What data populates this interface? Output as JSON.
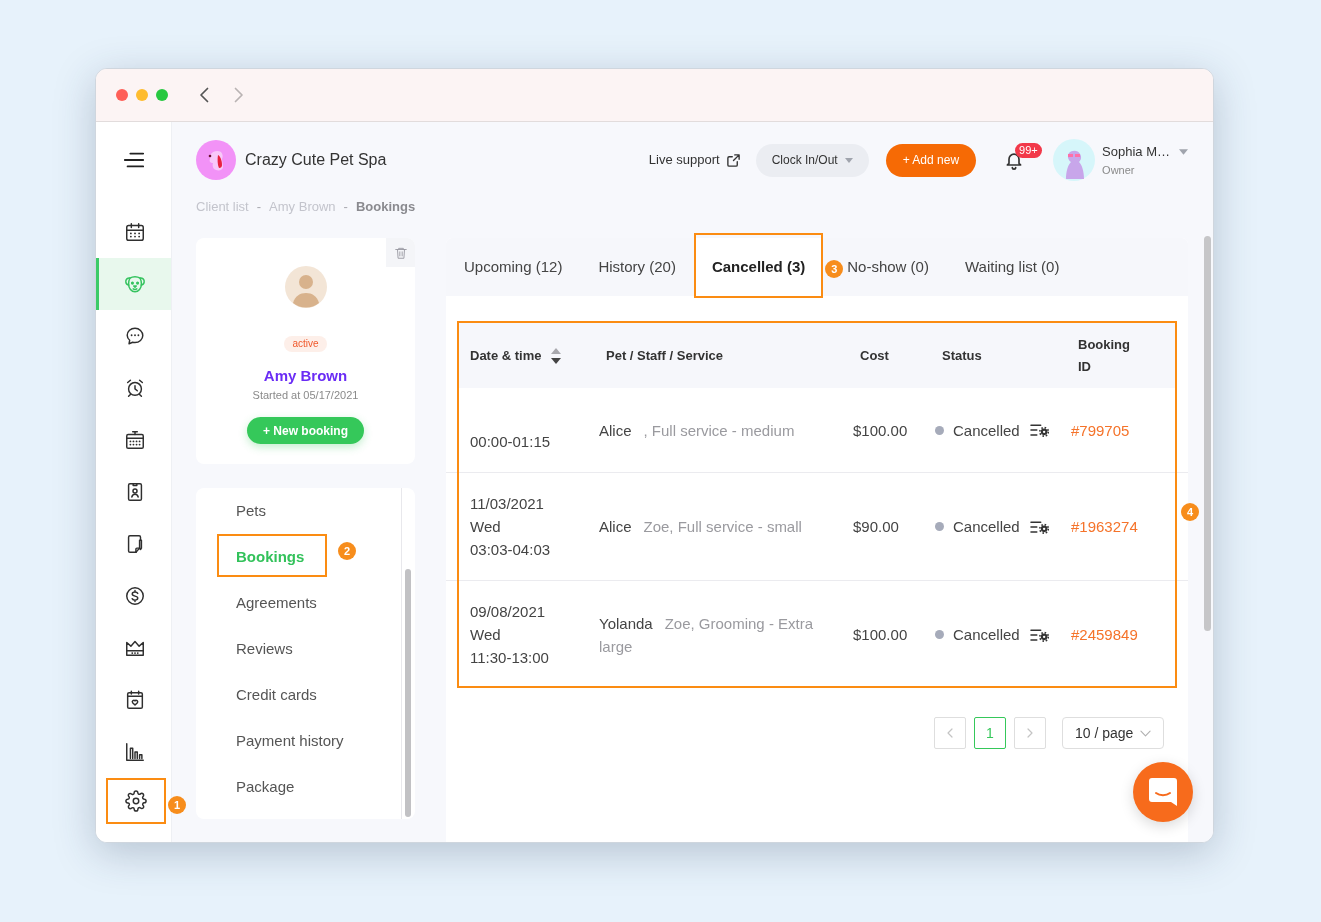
{
  "window": {
    "nav": [
      {
        "kind": "back",
        "disabled": false
      },
      {
        "kind": "forward",
        "disabled": true
      }
    ]
  },
  "sidebar": {
    "items": [
      {
        "kind": "calendar",
        "selected": false
      },
      {
        "kind": "pet",
        "selected": true
      },
      {
        "kind": "chat",
        "selected": false
      },
      {
        "kind": "alarm",
        "selected": false
      },
      {
        "kind": "booking",
        "selected": false
      },
      {
        "kind": "badge",
        "selected": false
      },
      {
        "kind": "document",
        "selected": false
      },
      {
        "kind": "dollar",
        "selected": false
      },
      {
        "kind": "crown",
        "selected": false
      },
      {
        "kind": "calendar_heart",
        "selected": false
      },
      {
        "kind": "chart",
        "selected": false
      },
      {
        "kind": "settings",
        "selected": false,
        "annotation": "1"
      }
    ]
  },
  "header": {
    "brand": "Crazy Cute Pet Spa",
    "live_support": "Live support",
    "clock_button": "Clock In/Out",
    "add_button": "+ Add new",
    "notification_count": "99+",
    "user": {
      "name": "Sophia M…",
      "role": "Owner"
    }
  },
  "breadcrumb": [
    {
      "kind": "link",
      "label": "Client list"
    },
    {
      "kind": "separator",
      "label": "-"
    },
    {
      "kind": "link",
      "label": "Amy Brown"
    },
    {
      "kind": "separator",
      "label": "-"
    },
    {
      "kind": "current",
      "label": "Bookings"
    }
  ],
  "client_card": {
    "status": "active",
    "name": "Amy Brown",
    "started": "Started at 05/17/2021",
    "new_booking_button": "+ New booking"
  },
  "client_menu": {
    "items": [
      {
        "label": "Pets",
        "selected": false
      },
      {
        "label": "Bookings",
        "selected": true,
        "annotation": "2"
      },
      {
        "label": "Agreements",
        "selected": false
      },
      {
        "label": "Reviews",
        "selected": false
      },
      {
        "label": "Credit cards",
        "selected": false
      },
      {
        "label": "Payment history",
        "selected": false
      },
      {
        "label": "Package",
        "selected": false
      }
    ]
  },
  "tabs": [
    {
      "label": "Upcoming (12)",
      "selected": false
    },
    {
      "label": "History (20)",
      "selected": false
    },
    {
      "label": "Cancelled (3)",
      "selected": true,
      "annotation": "3"
    },
    {
      "label": "No-show (0)",
      "selected": false
    },
    {
      "label": "Waiting list (0)",
      "selected": false
    }
  ],
  "table": {
    "annotation": "4",
    "columns": [
      {
        "label": "Date & time",
        "sortable": true,
        "sorted_descending": true
      },
      {
        "label": "Pet / Staff / Service"
      },
      {
        "label": "Cost"
      },
      {
        "label": "Status"
      },
      {
        "label": "Booking ID"
      }
    ],
    "rows": [
      {
        "time": "00:00-01:15",
        "pet": "Alice",
        "details": ", Full service - medium",
        "cost": "$100.00",
        "status": "Cancelled",
        "booking_id": "#799705"
      },
      {
        "date": "11/03/2021",
        "day": "Wed",
        "time": "03:03-04:03",
        "pet": "Alice",
        "details": "Zoe, Full service - small",
        "cost": "$90.00",
        "status": "Cancelled",
        "booking_id": "#1963274"
      },
      {
        "date": "09/08/2021",
        "day": "Wed",
        "time": "11:30-13:00",
        "pet": "Yolanda",
        "details": "Zoe, Grooming - Extra large",
        "cost": "$100.00",
        "status": "Cancelled",
        "booking_id": "#2459849"
      }
    ]
  },
  "pagination": {
    "previous": {
      "disabled": true
    },
    "pages": [
      {
        "label": "1",
        "selected": true
      }
    ],
    "next": {
      "disabled": true
    },
    "page_size": "10 / page"
  }
}
